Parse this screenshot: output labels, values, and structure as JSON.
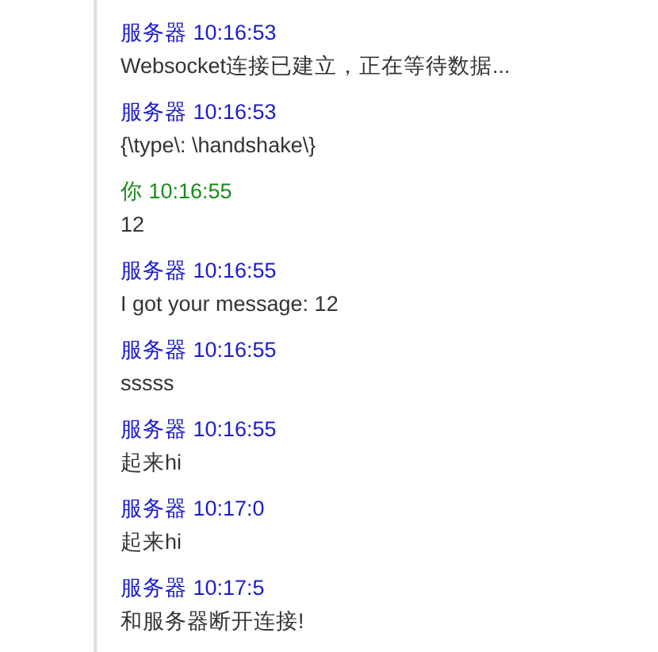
{
  "messages": [
    {
      "kind": "server",
      "header": "服务器 10:16:53",
      "body": "Websocket连接已建立，正在等待数据..."
    },
    {
      "kind": "server",
      "header": "服务器 10:16:53",
      "body": "{\\type\\: \\handshake\\}"
    },
    {
      "kind": "you",
      "header": "你 10:16:55",
      "body": "12"
    },
    {
      "kind": "server",
      "header": "服务器 10:16:55",
      "body": "I got your message: 12"
    },
    {
      "kind": "server",
      "header": "服务器 10:16:55",
      "body": "sssss"
    },
    {
      "kind": "server",
      "header": "服务器 10:16:55",
      "body": "起来hi"
    },
    {
      "kind": "server",
      "header": "服务器 10:17:0",
      "body": "起来hi"
    },
    {
      "kind": "server",
      "header": "服务器 10:17:5",
      "body": "和服务器断开连接!"
    }
  ]
}
